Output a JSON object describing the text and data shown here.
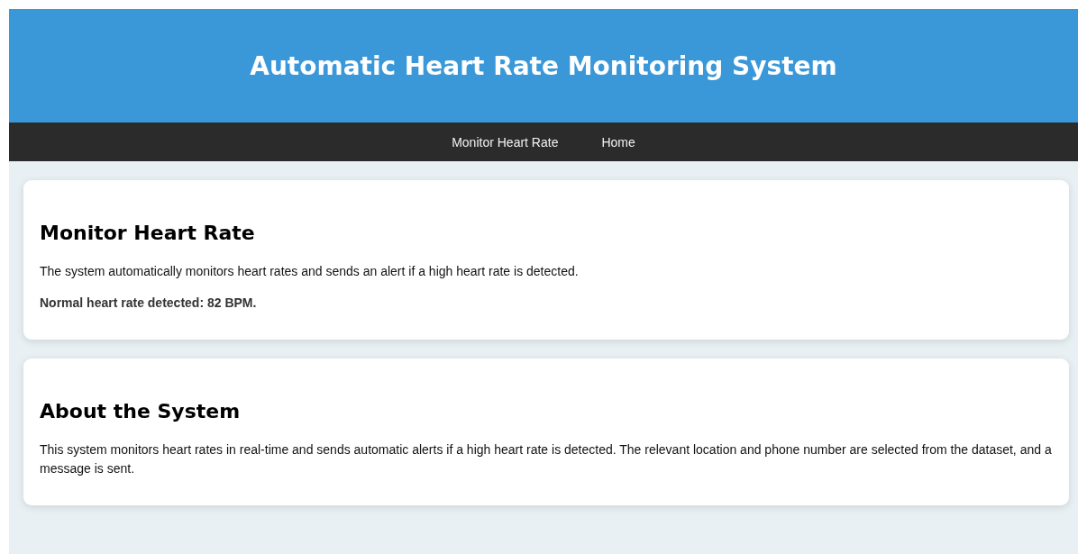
{
  "header": {
    "title": "Automatic Heart Rate Monitoring System"
  },
  "nav": {
    "items": [
      {
        "label": "Monitor Heart Rate"
      },
      {
        "label": "Home"
      }
    ]
  },
  "sections": [
    {
      "heading": "Monitor Heart Rate",
      "paragraphs": [
        {
          "kind": "text",
          "text": "The system automatically monitors heart rates and sends an alert if a high heart rate is detected."
        },
        {
          "kind": "status",
          "text": "Normal heart rate detected: 82 BPM."
        }
      ]
    },
    {
      "heading": "About the System",
      "paragraphs": [
        {
          "kind": "text",
          "text": "This system monitors heart rates in real-time and sends automatic alerts if a high heart rate is detected. The relevant location and phone number are selected from the dataset, and a message is sent."
        }
      ]
    }
  ]
}
